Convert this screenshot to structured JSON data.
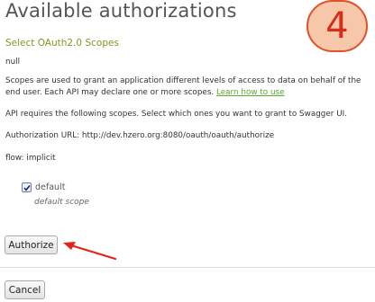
{
  "title": "Available authorizations",
  "subtitle": "Select OAuth2.0 Scopes",
  "null_text": "null",
  "description": "Scopes are used to grant an application different levels of access to data on behalf of the end user. Each API may declare one or more scopes.",
  "learn_link": "Learn how to use",
  "requirement_text": "API requires the following scopes. Select which ones you want to grant to Swagger UI.",
  "authorization_url": "Authorization URL: http://dev.hzero.org:8080/oauth/oauth/authorize",
  "flow": "flow: implicit",
  "scope": {
    "name": "default",
    "description": "default scope",
    "checked": true
  },
  "authorize_button": "Authorize",
  "cancel_button": "Cancel",
  "annotation_number": "4",
  "colors": {
    "annotation": "#d72c1b",
    "annotation_fill": "#f6c7a8",
    "link": "#5cac2e",
    "subtitle": "#7e9a22"
  }
}
